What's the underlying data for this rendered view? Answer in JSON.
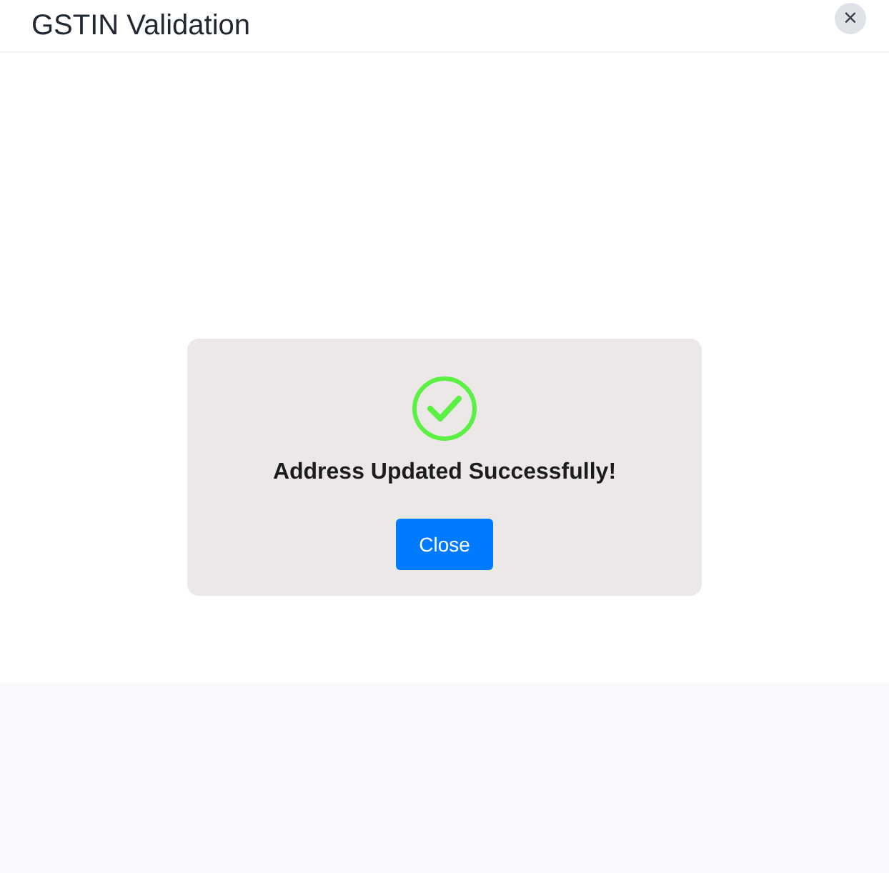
{
  "window": {
    "title": "GSTIN Validation",
    "close": "×"
  },
  "alert": {
    "message": "Address Updated Successfully!",
    "button": "Close"
  }
}
